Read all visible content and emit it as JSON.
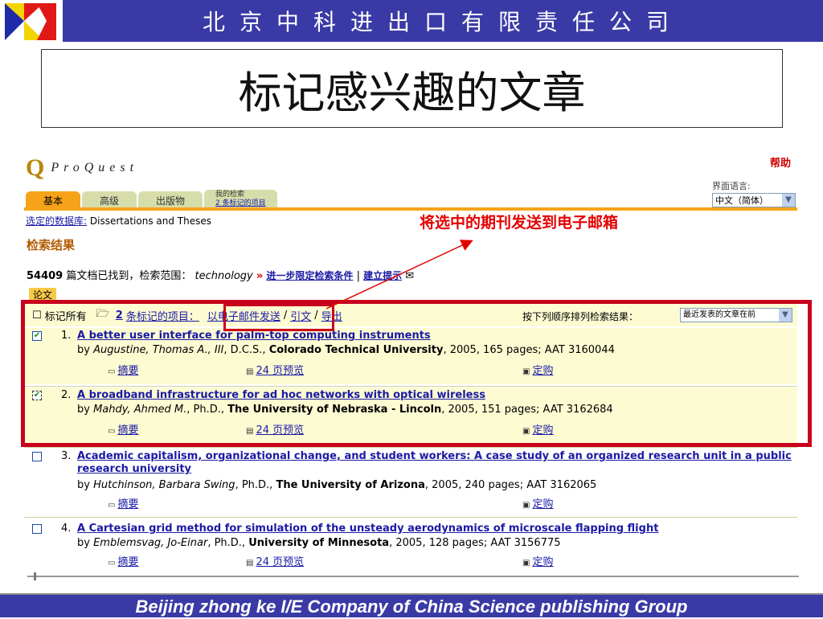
{
  "slide": {
    "company": "北京中科进出口有限责任公司",
    "title": "标记感兴趣的文章",
    "footer": "Beijing  zhong ke I/E Company of China Science publishing Group"
  },
  "proquest": {
    "logo_text": "ProQuest",
    "help": "帮助",
    "language_label": "界面语言:",
    "language_value": "中文（简体）",
    "tabs": [
      "基本",
      "高级",
      "出版物"
    ],
    "my_search": {
      "label": "我的检索",
      "link": "2 条标记的项目"
    },
    "db_label": "选定的数据库:",
    "db_name": "Dissertations and Theses",
    "annotation": "将选中的期刊发送到电子邮箱",
    "results_title": "检索结果",
    "count": "54409",
    "count_text": "篇文档已找到，检索范围：",
    "query": "technology",
    "refine": "进一步限定检索条件",
    "alert": "建立提示",
    "badge": "论文",
    "toolbar": {
      "mark_all": "标记所有",
      "marked_count": "2",
      "marked_items": "条标记的项目：",
      "email": "以电子邮件发送",
      "cite": "引文",
      "export": "导出",
      "sort_label": "按下列顺序排列检索结果：",
      "sort_value": "最近发表的文章在前"
    },
    "records": [
      {
        "num": "1.",
        "checked": "true",
        "title": "A better user interface for palm-top computing instruments",
        "by": "by",
        "author": "Augustine, Thomas A., III",
        "degree": ", D.C.S.,",
        "school": "Colorado Technical University",
        "details": ", 2005, 165 pages; AAT 3160044",
        "abstract": "摘要",
        "preview": "24 页预览",
        "order": "定购"
      },
      {
        "num": "2.",
        "checked": "true",
        "title": "A broadband infrastructure for ad hoc networks with optical wireless",
        "by": "by",
        "author": "Mahdy, Ahmed M.",
        "degree": ", Ph.D.,",
        "school": "The University of Nebraska - Lincoln",
        "details": ", 2005, 151 pages; AAT 3162684",
        "abstract": "摘要",
        "preview": "24 页预览",
        "order": "定购"
      },
      {
        "num": "3.",
        "checked": "false",
        "title": "Academic capitalism, organizational change, and student workers: A case study of an organized research unit in a public research university",
        "by": "by",
        "author": "Hutchinson, Barbara Swing",
        "degree": ", Ph.D.,",
        "school": "The University of Arizona",
        "details": ", 2005, 240 pages; AAT 3162065",
        "abstract": "摘要",
        "order": "定购"
      },
      {
        "num": "4.",
        "checked": "false",
        "title": "A Cartesian grid method for simulation of the unsteady aerodynamics of microscale flapping flight",
        "by": "by",
        "author": "Emblemsvag, Jo-Einar",
        "degree": ", Ph.D.,",
        "school": "University of Minnesota",
        "details": ", 2005, 128 pages; AAT 3156775",
        "abstract": "摘要",
        "preview": "24 页预览",
        "order": "定购"
      }
    ]
  }
}
